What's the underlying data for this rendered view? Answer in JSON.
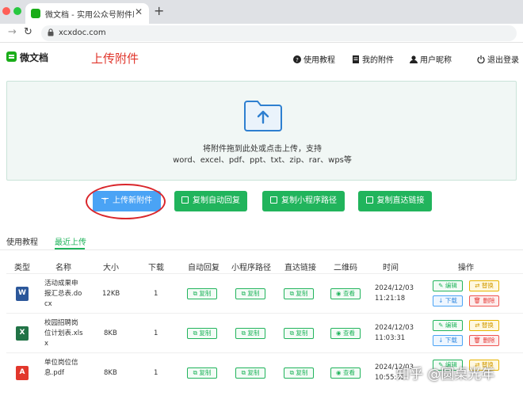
{
  "browser": {
    "tab_title": "微文档 - 实用公众号附件助手,",
    "url": "xcxdoc.com"
  },
  "header": {
    "logo": "微文档",
    "page_title": "上传附件",
    "nav": [
      "使用教程",
      "我的附件",
      "用户昵称",
      "退出登录"
    ]
  },
  "upload": {
    "hint_line1": "将附件拖到此处或点击上传，支持",
    "hint_line2": "word、excel、pdf、ppt、txt、zip、rar、wps等"
  },
  "actions": {
    "upload_new": "上传新附件",
    "copy_auto_reply": "复制自动回复",
    "copy_mini_path": "复制小程序路径",
    "copy_direct_link": "复制直达链接"
  },
  "tabs": [
    "使用教程",
    "最近上传"
  ],
  "table": {
    "headers": [
      "类型",
      "名称",
      "大小",
      "下载",
      "自动回复",
      "小程序路径",
      "直达链接",
      "二维码",
      "时间",
      "操作"
    ],
    "copy_label": "复制",
    "view_label": "查看",
    "op_labels": {
      "edit": "编辑",
      "replace": "替换",
      "download": "下载",
      "delete": "删除"
    },
    "rows": [
      {
        "type": "word",
        "icon_text": "W",
        "icon_color": "#2b579a",
        "name": "活动成果申报汇总表.docx",
        "size": "12KB",
        "downloads": "1",
        "time": "2024/12/03 11:21:18"
      },
      {
        "type": "excel",
        "icon_text": "X",
        "icon_color": "#217346",
        "name": "校园招聘岗位计划表.xlsx",
        "size": "8KB",
        "downloads": "1",
        "time": "2024/12/03 11:03:31"
      },
      {
        "type": "pdf",
        "icon_text": "A",
        "icon_color": "#e2372c",
        "name": "单位岗位信息.pdf",
        "size": "8KB",
        "downloads": "1",
        "time": "2024/12/03 10:55:32"
      }
    ]
  },
  "watermark": "知乎 @圆桌光年",
  "colors": {
    "accent_green": "#21b45c",
    "accent_blue": "#4aa3f5",
    "title_red": "#e0352b"
  }
}
